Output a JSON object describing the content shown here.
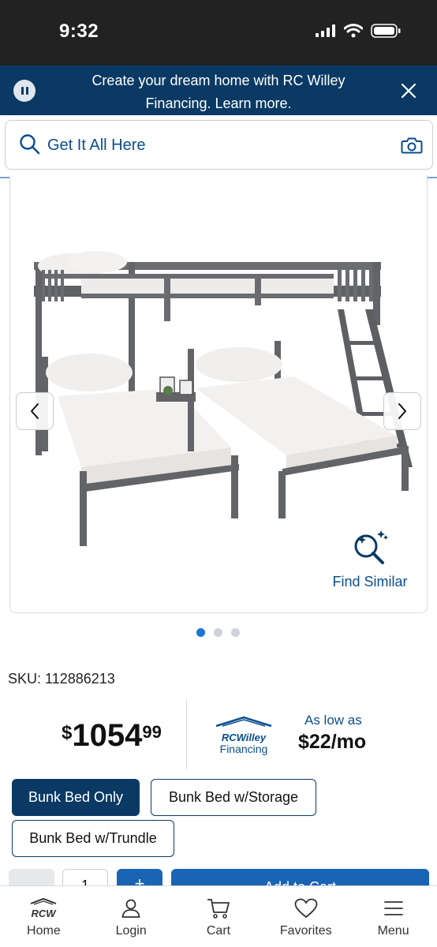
{
  "status_bar": {
    "time": "9:32"
  },
  "banner": {
    "text": "Create your dream home with RC Willey Financing. Learn more.",
    "bg_color": "#0a3a64"
  },
  "search": {
    "placeholder": "Get It All Here"
  },
  "image_gallery": {
    "find_similar_label": "Find Similar",
    "slide_count": 3,
    "active_slide": 1
  },
  "product": {
    "sku": "SKU: 112886213"
  },
  "pricing": {
    "currency": "$",
    "dollars": "1054",
    "cents": "99",
    "financing_brand": "RCWilley",
    "financing_word": "Financing",
    "as_low_as": "As low as",
    "monthly": "$22/mo"
  },
  "options": [
    {
      "label": "Bunk Bed Only",
      "selected": true
    },
    {
      "label": "Bunk Bed w/Storage",
      "selected": false
    },
    {
      "label": "Bunk Bed w/Trundle",
      "selected": false
    }
  ],
  "cart_row": {
    "quantity": "1",
    "plus": "+",
    "add_to_cart": "Add to Cart"
  },
  "tab_bar": {
    "home_logo": "RCW",
    "items": [
      {
        "label": "Home",
        "icon": "home-logo-icon"
      },
      {
        "label": "Login",
        "icon": "user-icon"
      },
      {
        "label": "Cart",
        "icon": "cart-icon"
      },
      {
        "label": "Favorites",
        "icon": "heart-icon"
      },
      {
        "label": "Menu",
        "icon": "menu-icon"
      }
    ]
  },
  "colors": {
    "brand_navy": "#0a3a64",
    "link_blue": "#0a4d8f",
    "button_blue": "#1b64b3",
    "active_dot": "#1877d2"
  }
}
